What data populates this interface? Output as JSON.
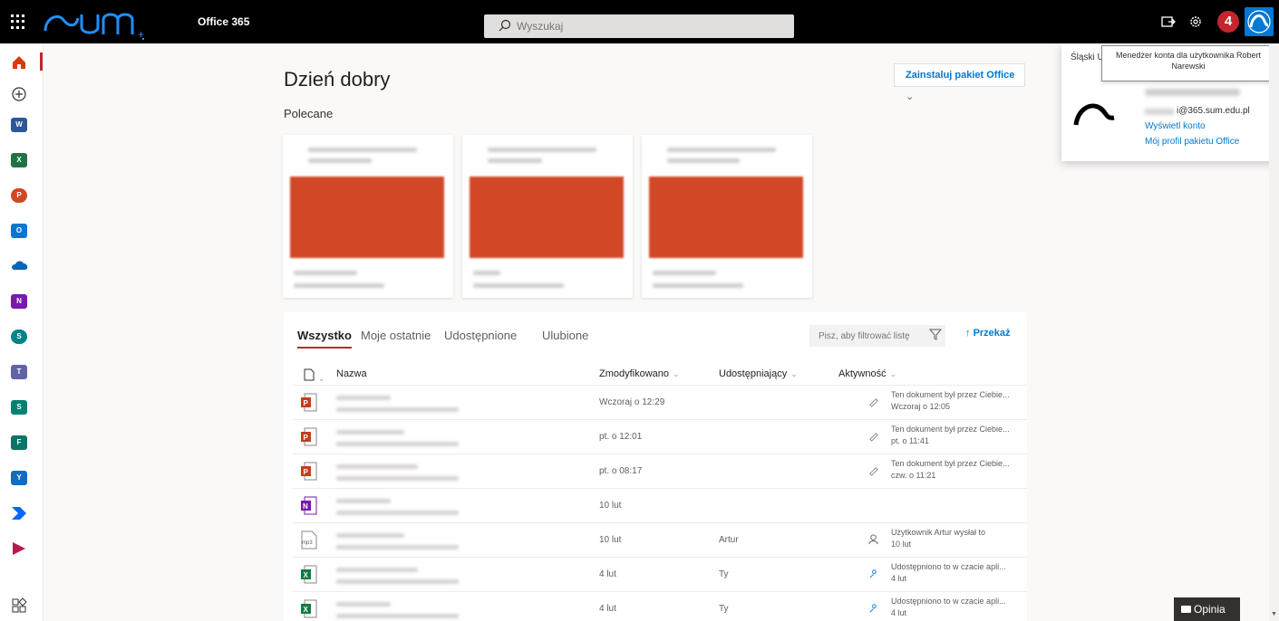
{
  "topbar": {
    "app_name": "Office 365",
    "search_placeholder": "Wyszukaj",
    "notification_count": "4",
    "icons": [
      "waffle-icon",
      "sum-logo",
      "search-icon",
      "share-icon",
      "settings-icon",
      "account-avatar"
    ]
  },
  "rail": {
    "items": [
      {
        "name": "home",
        "letter": "",
        "color": "#d83b01"
      },
      {
        "name": "create",
        "letter": "",
        "color": "#323130"
      },
      {
        "name": "word",
        "letter": "W",
        "color": "#2b579a"
      },
      {
        "name": "excel",
        "letter": "X",
        "color": "#217346"
      },
      {
        "name": "powerpoint",
        "letter": "P",
        "color": "#d24726"
      },
      {
        "name": "outlook",
        "letter": "O",
        "color": "#0078d4"
      },
      {
        "name": "onedrive",
        "letter": "",
        "color": "#0364b8"
      },
      {
        "name": "onenote",
        "letter": "N",
        "color": "#7719aa"
      },
      {
        "name": "sharepoint",
        "letter": "S",
        "color": "#038387"
      },
      {
        "name": "teams",
        "letter": "T",
        "color": "#6264a7"
      },
      {
        "name": "sway",
        "letter": "S",
        "color": "#008272"
      },
      {
        "name": "forms",
        "letter": "F",
        "color": "#077568"
      },
      {
        "name": "yammer",
        "letter": "Y",
        "color": "#106ebe"
      },
      {
        "name": "power-automate",
        "letter": "",
        "color": "#0066ff"
      },
      {
        "name": "stream",
        "letter": "",
        "color": "#bc1948"
      },
      {
        "name": "all-apps",
        "letter": "",
        "color": "#323130"
      }
    ]
  },
  "main": {
    "greeting": "Dzień dobry",
    "install_button": "Zainstaluj pakiet Office",
    "recommended_title": "Polecane"
  },
  "files": {
    "tabs": [
      "Wszystko",
      "Moje ostatnie",
      "Udostępnione",
      "Ulubione"
    ],
    "filter_placeholder": "Pisz, aby filtrować listę",
    "upload_label": "Przekaż",
    "columns": {
      "name": "Nazwa",
      "modified": "Zmodyfikowano",
      "shared_by": "Udostępniający",
      "activity": "Aktywność"
    },
    "rows": [
      {
        "type": "ppt",
        "modified": "Wczoraj o 12:29",
        "shared_by": "",
        "activity_1": "Ten dokument był przez Ciebie...",
        "activity_2": "Wczoraj o 12:05",
        "activity_icon": "edit-icon"
      },
      {
        "type": "ppt",
        "modified": "pt. o 12:01",
        "shared_by": "",
        "activity_1": "Ten dokument był przez Ciebie...",
        "activity_2": "pt. o 11:41",
        "activity_icon": "edit-icon"
      },
      {
        "type": "ppt",
        "modified": "pt. o 08:17",
        "shared_by": "",
        "activity_1": "Ten dokument był przez Ciebie...",
        "activity_2": "czw. o 11:21",
        "activity_icon": "edit-icon"
      },
      {
        "type": "onenote",
        "modified": "10 lut",
        "shared_by": "",
        "activity_1": "",
        "activity_2": "",
        "activity_icon": ""
      },
      {
        "type": "mp3",
        "modified": "10 lut",
        "shared_by": "Artur",
        "activity_1": "Użytkownik Artur wysłał to",
        "activity_2": "10 lut",
        "activity_icon": "person-icon"
      },
      {
        "type": "excel",
        "modified": "4 lut",
        "shared_by": "Ty",
        "activity_1": "Udostępniono to w czacie apli...",
        "activity_2": "4 lut",
        "activity_icon": "share-people-icon"
      },
      {
        "type": "excel",
        "modified": "4 lut",
        "shared_by": "Ty",
        "activity_1": "Udostępniono to w czacie apli...",
        "activity_2": "4 lut",
        "activity_icon": "share-people-icon"
      }
    ]
  },
  "account": {
    "org": "Śląski U",
    "tooltip": "Menedżer konta dla użytkownika Robert Narewski",
    "email_suffix": "i@365.sum.edu.pl",
    "view_account": "Wyświetl konto",
    "office_profile": "Mój profil pakietu Office"
  },
  "feedback_label": "Opinia"
}
